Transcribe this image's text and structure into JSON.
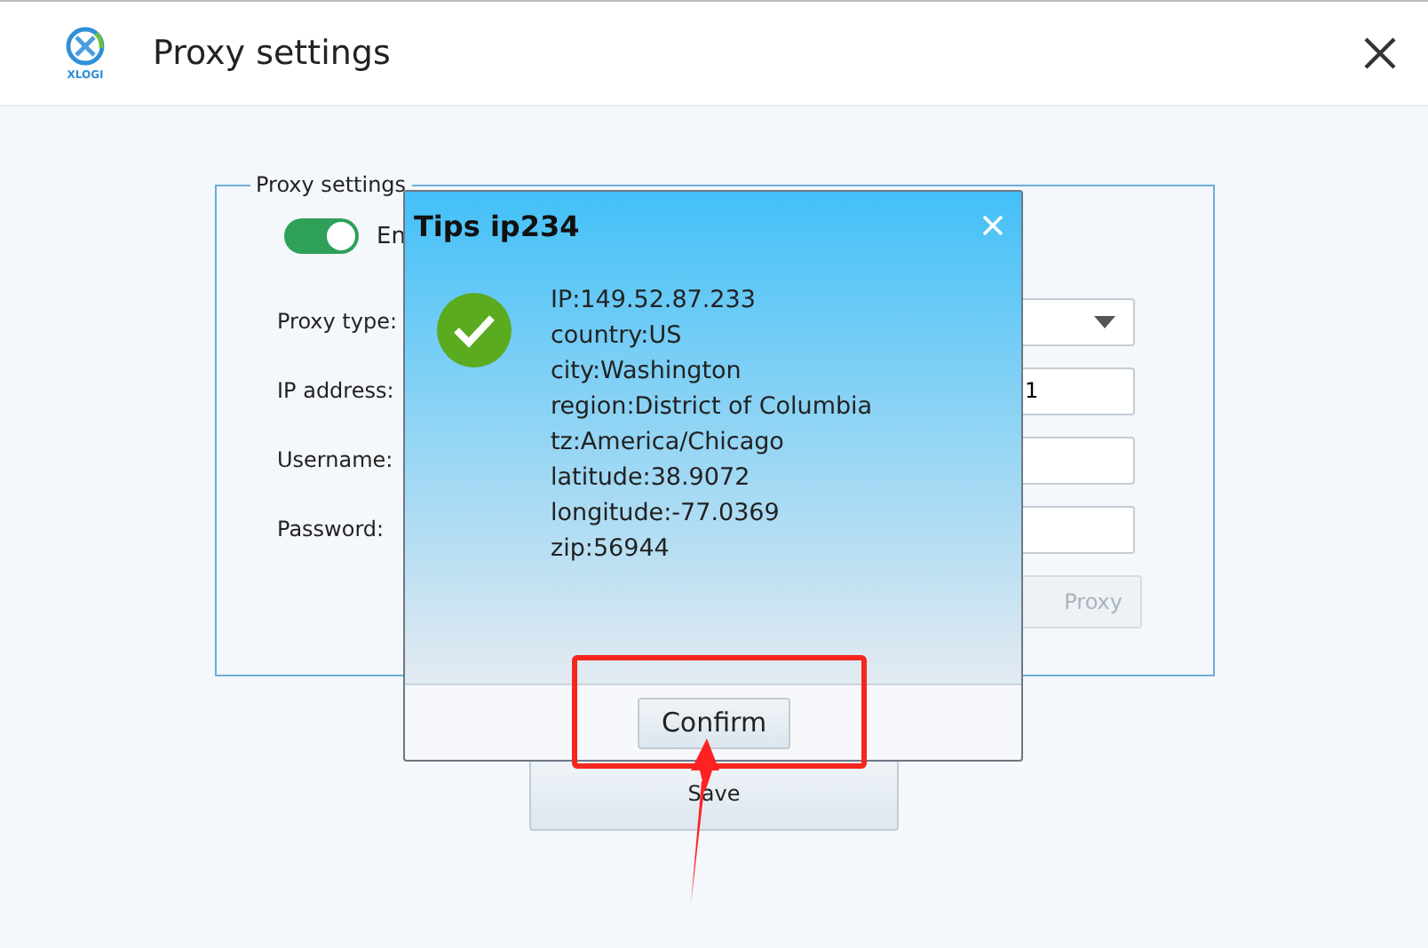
{
  "window": {
    "title": "Proxy settings",
    "logo_text": "XLOGI"
  },
  "group": {
    "title": "Proxy settings",
    "toggle": {
      "label": "En",
      "on": true
    },
    "fields": [
      {
        "label": "Proxy type:",
        "kind": "dropdown"
      },
      {
        "label": "IP address:",
        "kind": "text",
        "value": "1"
      },
      {
        "label": "Username:",
        "kind": "text"
      },
      {
        "label": "Password:",
        "kind": "text"
      }
    ],
    "test_button": {
      "label": "Proxy",
      "disabled": true
    }
  },
  "save_button": "Save",
  "dialog": {
    "title": "Tips ip234",
    "lines": [
      "IP:149.52.87.233",
      "country:US",
      "city:Washington",
      "region:District of Columbia",
      "tz:America/Chicago",
      "latitude:38.9072",
      "longitude:-77.0369",
      "zip:56944"
    ],
    "confirm_button": "Confirm"
  }
}
